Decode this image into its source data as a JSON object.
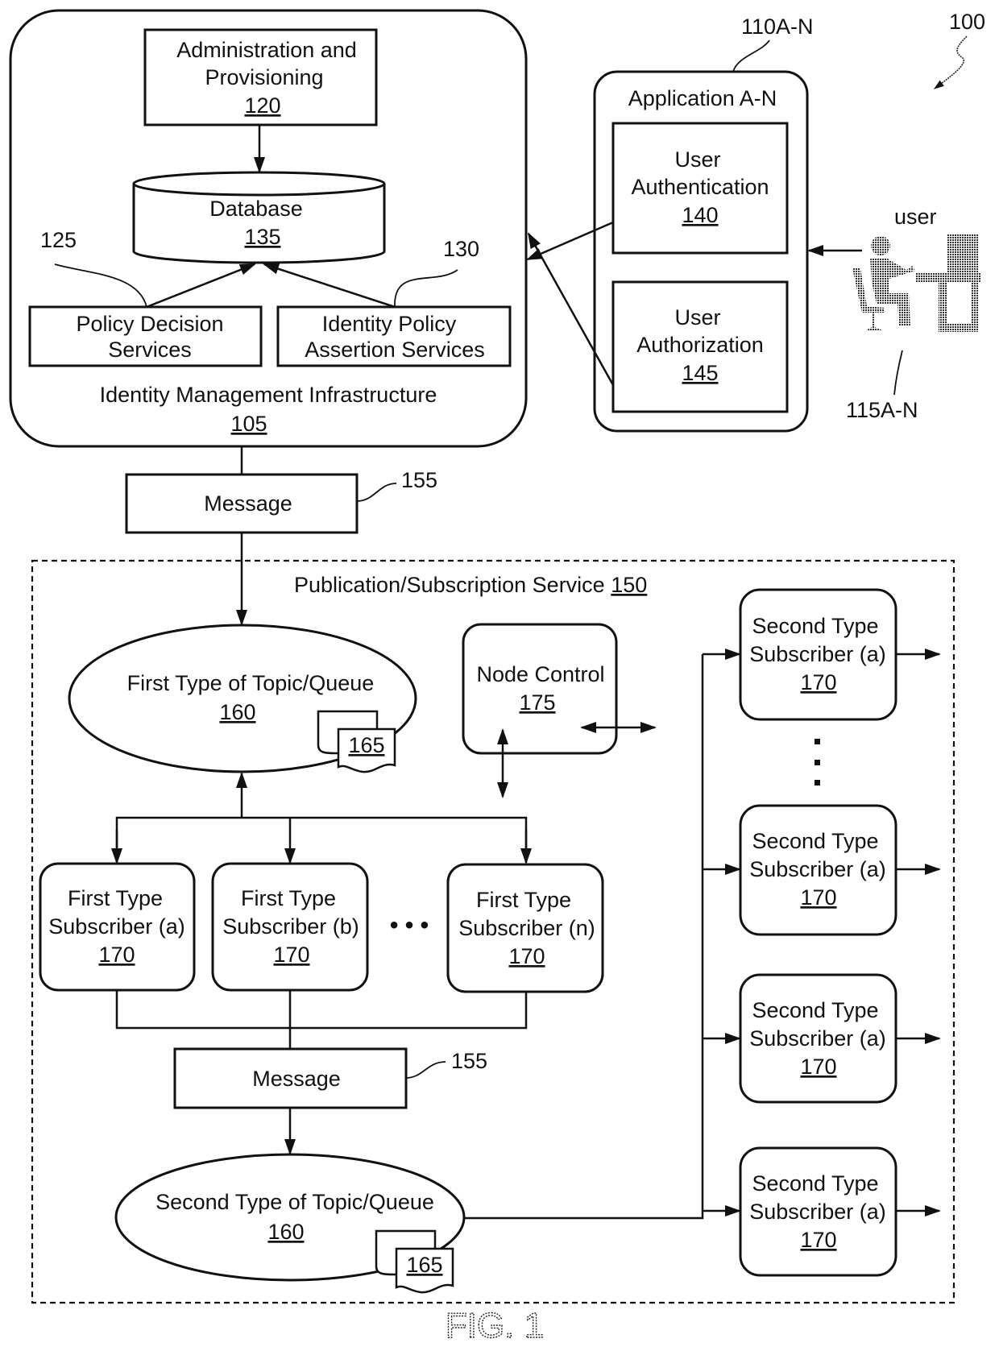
{
  "figure": {
    "label": "FIG. 1",
    "system_ref": "100"
  },
  "identity_management": {
    "title": "Identity Management Infrastructure",
    "ref": "105",
    "admin": {
      "line1": "Administration and",
      "line2": "Provisioning",
      "ref": "120"
    },
    "database": {
      "label": "Database",
      "ref": "135"
    },
    "policy_decision": {
      "line1": "Policy Decision",
      "line2": "Services",
      "callout": "125"
    },
    "identity_policy": {
      "line1": "Identity Policy",
      "line2": "Assertion Services",
      "callout": "130"
    }
  },
  "application": {
    "title": "Application A-N",
    "callout": "110A-N",
    "authentication": {
      "line1": "User",
      "line2": "Authentication",
      "ref": "140"
    },
    "authorization": {
      "line1": "User",
      "line2": "Authorization",
      "ref": "145"
    }
  },
  "user": {
    "label": "user",
    "callout": "115A-N",
    "icon": "user-at-computer-icon"
  },
  "message_top": {
    "label": "Message",
    "callout": "155"
  },
  "pubsub": {
    "title": "Publication/Subscription Service",
    "ref": "150",
    "first_topic": {
      "label": "First Type of Topic/Queue",
      "ref": "160",
      "doc_ref": "165"
    },
    "node_control": {
      "label": "Node Control",
      "ref": "175"
    },
    "first_subscribers": [
      {
        "line1": "First Type",
        "line2": "Subscriber (a)",
        "ref": "170"
      },
      {
        "line1": "First Type",
        "line2": "Subscriber (b)",
        "ref": "170"
      },
      {
        "line1": "First Type",
        "line2": "Subscriber (n)",
        "ref": "170"
      }
    ],
    "ellipsis": "• • •",
    "message_inner": {
      "label": "Message",
      "callout": "155"
    },
    "second_topic": {
      "label": "Second Type of Topic/Queue",
      "ref": "160",
      "doc_ref": "165"
    },
    "second_subscribers": [
      {
        "line1": "Second Type",
        "line2": "Subscriber (a)",
        "ref": "170"
      },
      {
        "line1": "Second Type",
        "line2": "Subscriber (a)",
        "ref": "170"
      },
      {
        "line1": "Second Type",
        "line2": "Subscriber (a)",
        "ref": "170"
      },
      {
        "line1": "Second Type",
        "line2": "Subscriber (a)",
        "ref": "170"
      }
    ]
  }
}
